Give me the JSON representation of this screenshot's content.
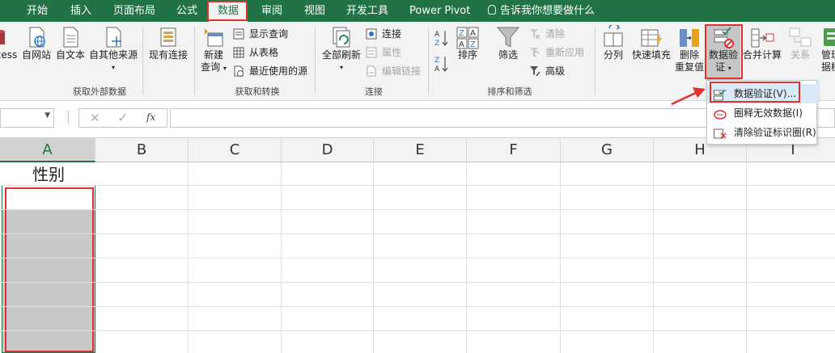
{
  "tabs": [
    "开始",
    "插入",
    "页面布局",
    "公式",
    "数据",
    "审阅",
    "视图",
    "开发工具",
    "Power Pivot"
  ],
  "active_tab": "数据",
  "tell_me": "告诉我你想要做什么",
  "ribbon": {
    "get_external": {
      "access": "cess",
      "web": "自网站",
      "text": "自文本",
      "other": "自其他来源",
      "existing": "现有连接",
      "group": "获取外部数据"
    },
    "get_transform": {
      "new_query_1": "新建",
      "new_query_2": "查询",
      "show_queries": "显示查询",
      "from_table": "从表格",
      "recent_sources": "最近使用的源",
      "group": "获取和转换"
    },
    "connections": {
      "refresh_all": "全部刷新",
      "connections": "连接",
      "properties": "属性",
      "edit_links": "编辑链接",
      "group": "连接"
    },
    "sort_filter": {
      "sort": "排序",
      "filter": "筛选",
      "clear": "清除",
      "reapply": "重新应用",
      "advanced": "高级",
      "group": "排序和筛选"
    },
    "data_tools": {
      "split": "分列",
      "flash_fill": "快速填充",
      "remove_dup_1": "删除",
      "remove_dup_2": "重复值",
      "validation_1": "数据验",
      "validation_2": "证",
      "consolidate": "合并计算",
      "relations": "关系",
      "manage_1": "管理",
      "manage_2": "据模"
    }
  },
  "formula_bar": {
    "fx": "fx",
    "name_value": "",
    "formula_value": ""
  },
  "columns": [
    "A",
    "B",
    "C",
    "D",
    "E",
    "F",
    "G",
    "H",
    "I"
  ],
  "cells": {
    "A1": "性别"
  },
  "dropdown": {
    "items": [
      "数据验证(V)...",
      "圈释无效数据(I)",
      "清除验证标识圈(R)"
    ]
  },
  "colors": {
    "excel_green": "#217346",
    "highlight_red": "#e0312f",
    "selection_gray": "#c8c8c8"
  }
}
